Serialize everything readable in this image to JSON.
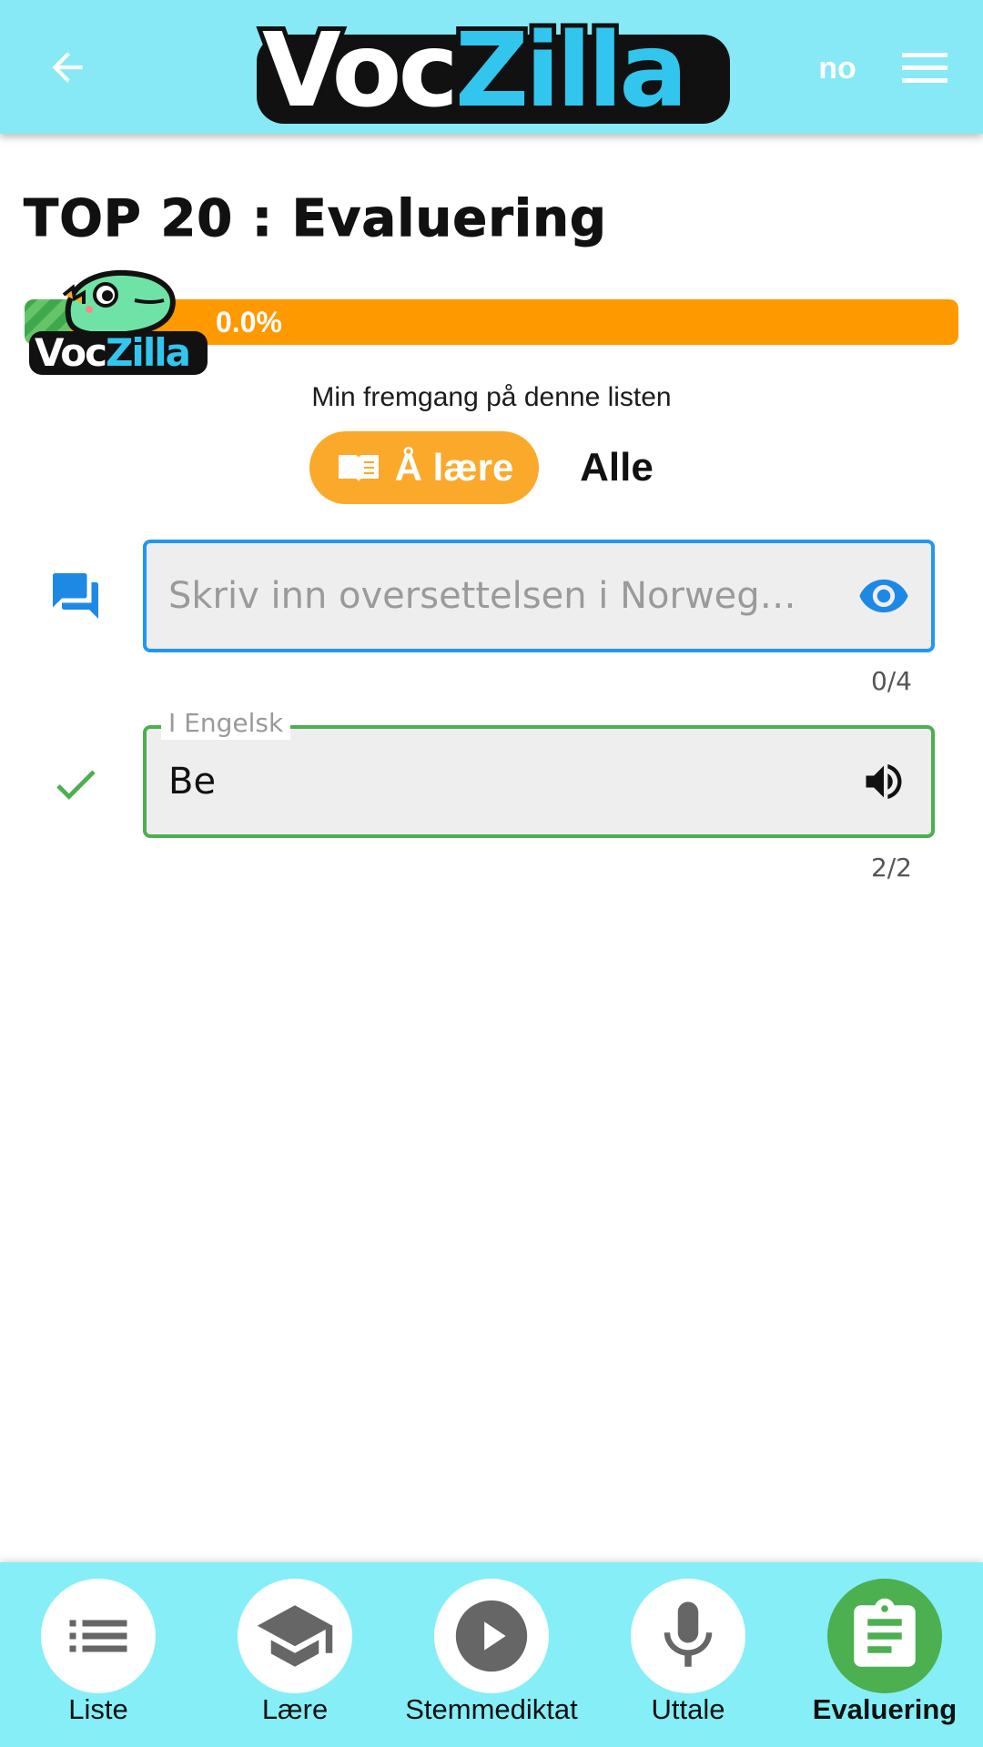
{
  "header": {
    "logo_text_left": "Voc",
    "logo_text_right": "Zilla",
    "language": "no"
  },
  "title": "TOP 20 : Evaluering",
  "progress": {
    "label": "0.0%",
    "value_percent": 0.0,
    "caption": "Min fremgang på denne listen",
    "mascot_text_left": "Voc",
    "mascot_text_right": "Zilla"
  },
  "modes": {
    "learn_label": "Å lære",
    "all_label": "Alle"
  },
  "question_field": {
    "placeholder": "Skriv inn oversettelsen i Norwegian",
    "counter": "0/4"
  },
  "answer_field": {
    "floating_label": "I Engelsk",
    "value": "Be",
    "counter": "2/2"
  },
  "nav": {
    "items": [
      {
        "label": "Liste",
        "icon": "list-icon"
      },
      {
        "label": "Lære",
        "icon": "school-icon"
      },
      {
        "label": "Stemmediktat",
        "icon": "play-icon"
      },
      {
        "label": "Uttale",
        "icon": "mic-icon"
      },
      {
        "label": "Evaluering",
        "icon": "clipboard-icon"
      }
    ],
    "active_index": 4
  },
  "colors": {
    "header_bg": "#86E9F5",
    "accent_orange": "#FF9900",
    "learn_button": "#FBA92B",
    "blue": "#2196F3",
    "green": "#4CAF50",
    "logo_blue": "#32C6EE"
  }
}
